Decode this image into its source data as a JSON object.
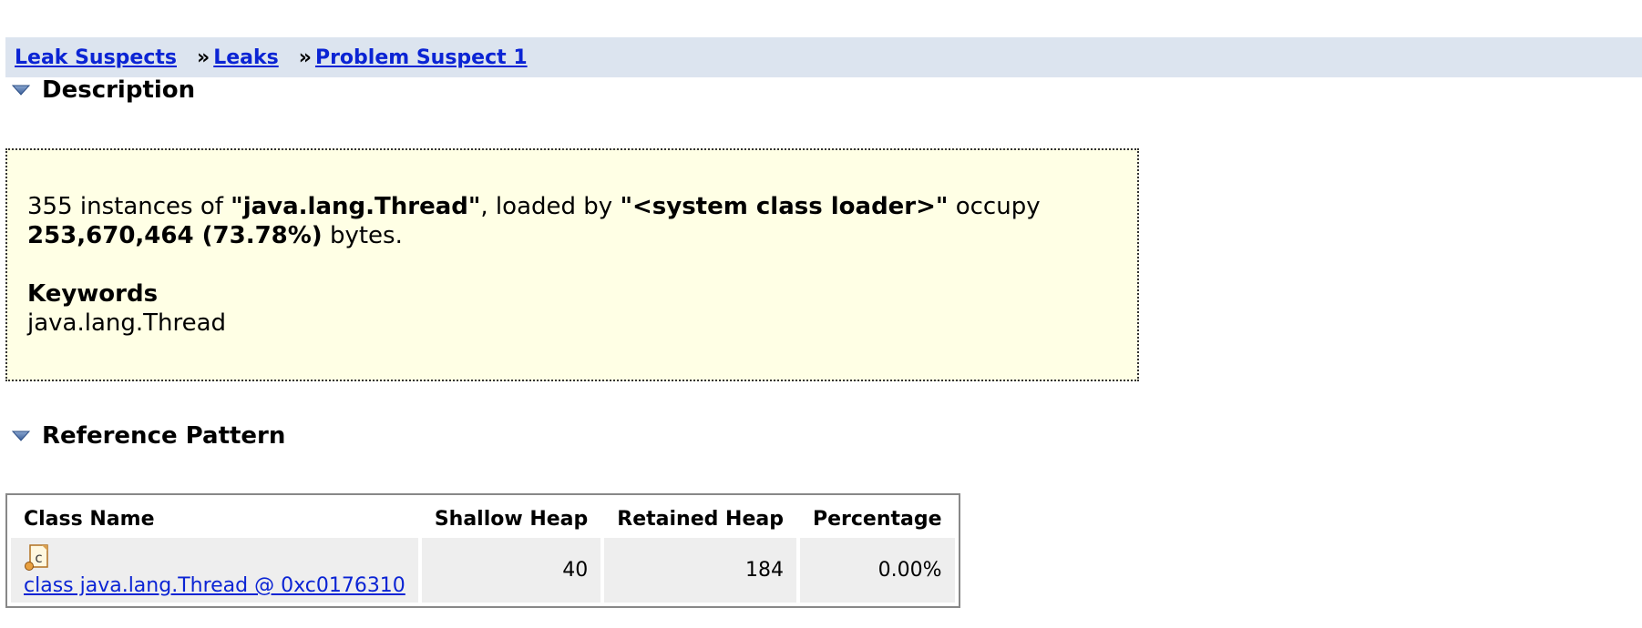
{
  "breadcrumb": {
    "items": [
      {
        "label": "Leak Suspects"
      },
      {
        "label": "Leaks"
      },
      {
        "label": "Problem Suspect 1"
      }
    ],
    "separator": "»"
  },
  "description": {
    "heading": "Description",
    "text": {
      "count": "355 instances of ",
      "class_name": "\"java.lang.Thread\"",
      "loaded_by": ", loaded by ",
      "loader": "\"<system class loader>\"",
      "occupy": " occupy",
      "size": "253,670,464 (73.78%)",
      "bytes": " bytes."
    },
    "keywords_title": "Keywords",
    "keywords": "java.lang.Thread"
  },
  "reference_pattern": {
    "heading": "Reference Pattern",
    "columns": [
      "Class Name",
      "Shallow Heap",
      "Retained Heap",
      "Percentage"
    ],
    "rows": [
      {
        "class_name": "class java.lang.Thread @ 0xc0176310",
        "icon": "class-icon",
        "shallow_heap": "40",
        "retained_heap": "184",
        "percentage": "0.00%"
      }
    ]
  },
  "colors": {
    "breadcrumb_bg": "#dce4ef",
    "link": "#0b24d4",
    "description_bg": "#ffffe5",
    "row_bg": "#eeeeee"
  }
}
